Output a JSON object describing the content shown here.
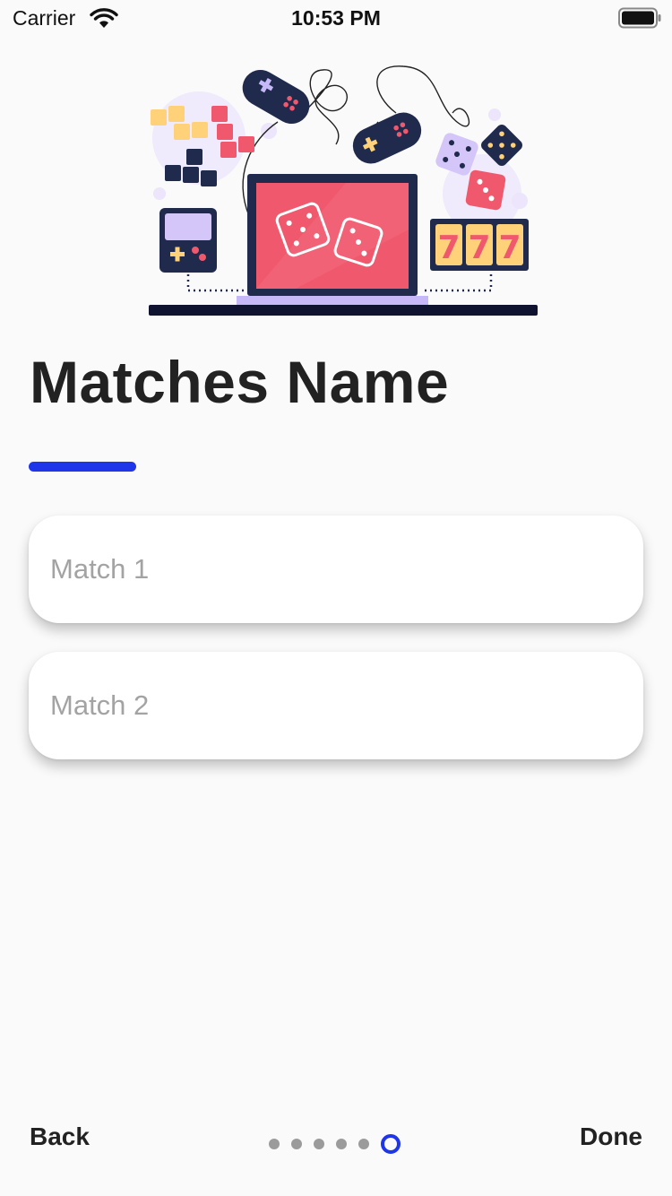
{
  "status_bar": {
    "carrier": "Carrier",
    "time": "10:53 PM",
    "wifi_icon": "wifi-icon",
    "battery_icon": "battery-full-icon"
  },
  "illustration": {
    "icon": "gaming-devices-illustration",
    "slot_symbols": [
      "7",
      "7",
      "7"
    ]
  },
  "page": {
    "title": "Matches Name"
  },
  "inputs": [
    {
      "placeholder": "Match 1",
      "value": ""
    },
    {
      "placeholder": "Match 2",
      "value": ""
    }
  ],
  "footer": {
    "back_label": "Back",
    "done_label": "Done",
    "page_count": 6,
    "current_page": 6
  },
  "colors": {
    "accent": "#1e35ea",
    "background": "#fafafa",
    "dot_inactive": "#9b9b9b",
    "title": "#222222"
  }
}
